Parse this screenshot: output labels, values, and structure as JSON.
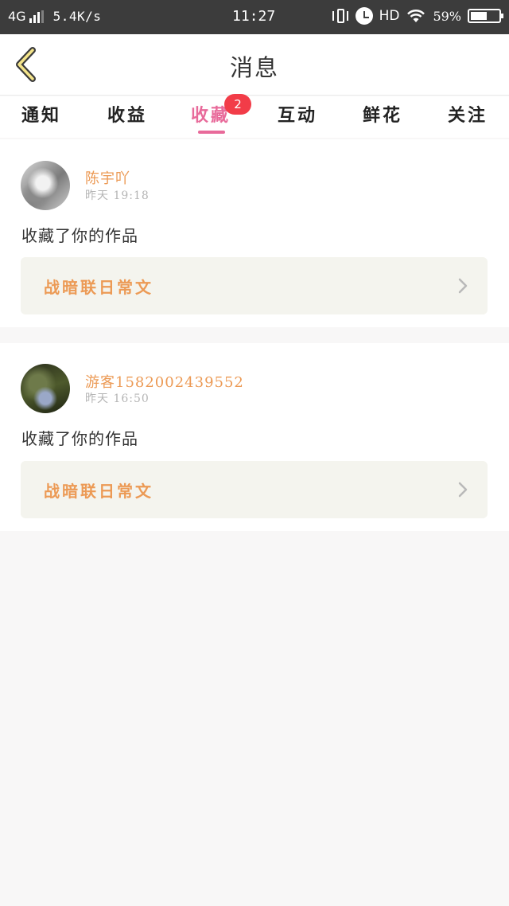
{
  "status_bar": {
    "network": "4G",
    "speed": "5.4K/s",
    "time": "11:27",
    "hd": "HD",
    "battery_text": "59%",
    "battery_level": 0.59,
    "signal_bars": 3
  },
  "header": {
    "title": "消息"
  },
  "tabs": [
    {
      "label": "通知",
      "active": false
    },
    {
      "label": "收益",
      "active": false
    },
    {
      "label": "收藏",
      "active": true,
      "badge": "2"
    },
    {
      "label": "互动",
      "active": false
    },
    {
      "label": "鲜花",
      "active": false
    },
    {
      "label": "关注",
      "active": false
    }
  ],
  "notifications": [
    {
      "user": "陈宇吖",
      "time": "昨天 19:18",
      "action": "收藏了你的作品",
      "work_title": "战暗联日常文"
    },
    {
      "user": "游客1582002439552",
      "time": "昨天 16:50",
      "action": "收藏了你的作品",
      "work_title": "战暗联日常文"
    }
  ],
  "colors": {
    "accent_pink": "#e86a9a",
    "badge_red": "#f23c48",
    "name_orange": "#ec9a55",
    "work_box_bg": "#f4f4ee",
    "status_bar_bg": "#3c3c3c",
    "page_bg": "#f8f7f7"
  },
  "icons": {
    "back": "chevron-left-icon",
    "work_arrow": "chevron-right-icon",
    "vibrate": "vibrate-icon",
    "alarm": "alarm-icon",
    "wifi": "wifi-icon",
    "battery": "battery-icon",
    "signal": "signal-icon"
  }
}
